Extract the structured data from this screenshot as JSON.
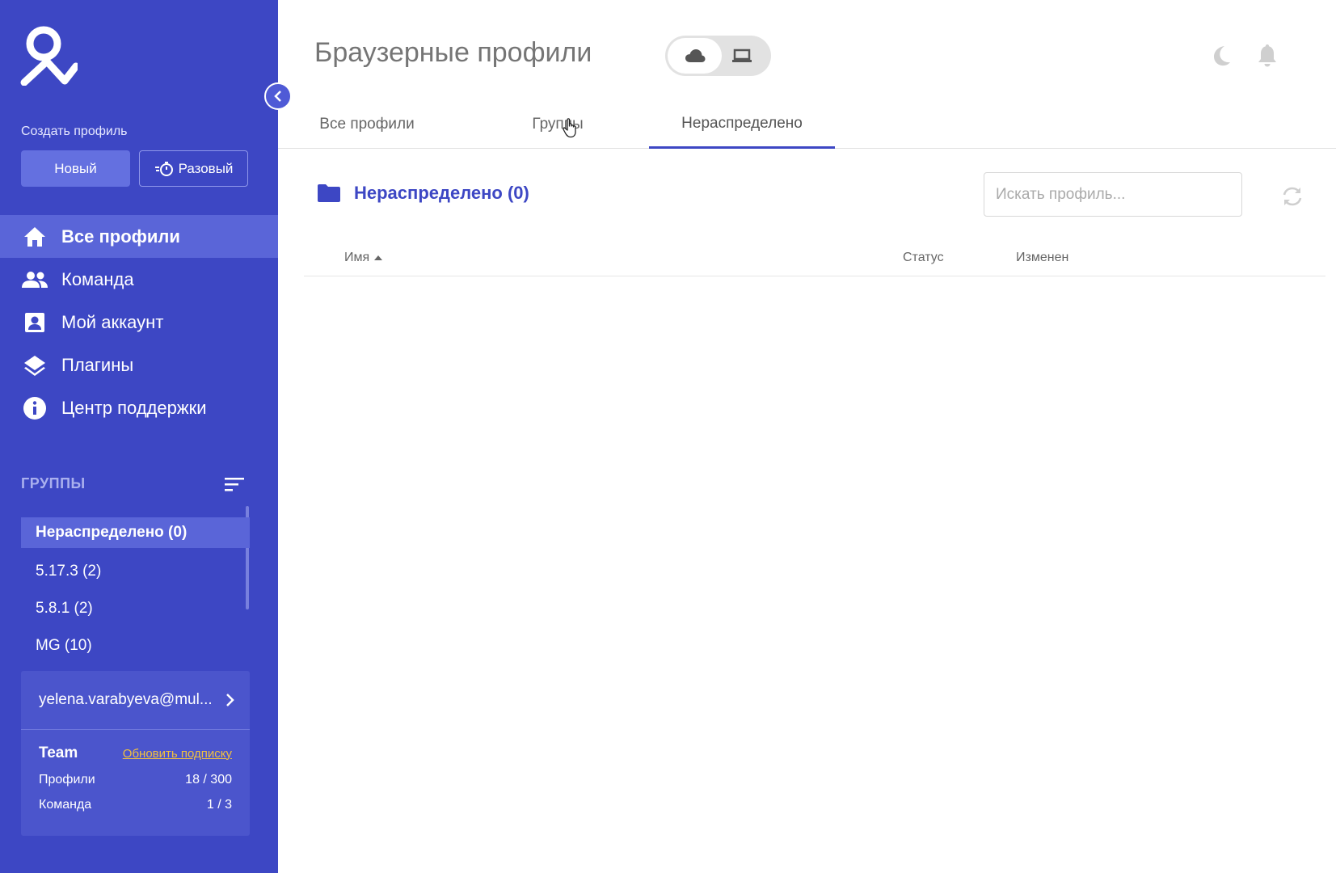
{
  "sidebar": {
    "create_label": "Создать профиль",
    "btn_new": "Новый",
    "btn_once": "Разовый",
    "nav": [
      {
        "label": "Все профили",
        "icon": "home-icon",
        "active": true
      },
      {
        "label": "Команда",
        "icon": "team-icon",
        "active": false
      },
      {
        "label": "Мой аккаунт",
        "icon": "account-icon",
        "active": false
      },
      {
        "label": "Плагины",
        "icon": "layers-icon",
        "active": false
      },
      {
        "label": "Центр поддержки",
        "icon": "info-icon",
        "active": false
      }
    ],
    "groups_title": "ГРУППЫ",
    "groups": [
      {
        "label": "Нераспределено (0)",
        "active": true
      },
      {
        "label": "5.17.3 (2)",
        "active": false
      },
      {
        "label": "5.8.1 (2)",
        "active": false
      },
      {
        "label": "MG (10)",
        "active": false
      }
    ],
    "account": {
      "email": "yelena.varabyeva@mul...",
      "plan": "Team",
      "upgrade_link": "Обновить подписку",
      "stats": [
        {
          "label": "Профили",
          "value": "18 / 300"
        },
        {
          "label": "Команда",
          "value": "1 / 3"
        }
      ]
    }
  },
  "main": {
    "title": "Браузерные профили",
    "tabs": [
      {
        "label": "Все профили",
        "active": false
      },
      {
        "label": "Группы",
        "active": false
      },
      {
        "label": "Нераспределено",
        "active": true
      }
    ],
    "folder_title": "Нераспределено (0)",
    "search_placeholder": "Искать профиль...",
    "columns": {
      "name": "Имя",
      "status": "Статус",
      "modified": "Изменен"
    }
  },
  "colors": {
    "sidebar_bg": "#3d47c4",
    "accent": "#3d47c4",
    "link": "#f0c040"
  }
}
